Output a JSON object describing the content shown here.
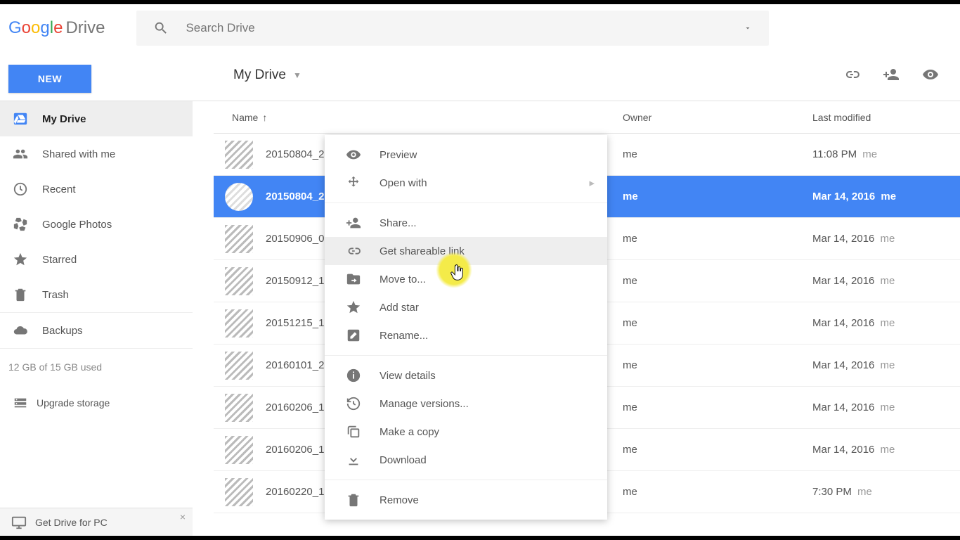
{
  "logo": {
    "g1": "G",
    "g2": "o",
    "g3": "o",
    "g4": "g",
    "g5": "l",
    "g6": "e",
    "drive": "Drive"
  },
  "search": {
    "placeholder": "Search Drive"
  },
  "new_button": "NEW",
  "breadcrumb": "My Drive",
  "sidebar": {
    "items": [
      {
        "label": "My Drive"
      },
      {
        "label": "Shared with me"
      },
      {
        "label": "Recent"
      },
      {
        "label": "Google Photos"
      },
      {
        "label": "Starred"
      },
      {
        "label": "Trash"
      }
    ],
    "backups": "Backups",
    "storage": "12 GB of 15 GB used",
    "upgrade": "Upgrade storage"
  },
  "columns": {
    "name": "Name",
    "owner": "Owner",
    "modified": "Last modified"
  },
  "files": [
    {
      "name": "20150804_2",
      "owner": "me",
      "modified": "11:08 PM",
      "by": "me"
    },
    {
      "name": "20150804_2",
      "owner": "me",
      "modified": "Mar 14, 2016",
      "by": "me"
    },
    {
      "name": "20150906_0",
      "owner": "me",
      "modified": "Mar 14, 2016",
      "by": "me"
    },
    {
      "name": "20150912_1",
      "owner": "me",
      "modified": "Mar 14, 2016",
      "by": "me"
    },
    {
      "name": "20151215_1",
      "owner": "me",
      "modified": "Mar 14, 2016",
      "by": "me"
    },
    {
      "name": "20160101_2",
      "owner": "me",
      "modified": "Mar 14, 2016",
      "by": "me"
    },
    {
      "name": "20160206_1",
      "owner": "me",
      "modified": "Mar 14, 2016",
      "by": "me"
    },
    {
      "name": "20160206_1",
      "owner": "me",
      "modified": "Mar 14, 2016",
      "by": "me"
    },
    {
      "name": "20160220_1",
      "owner": "me",
      "modified": "7:30 PM",
      "by": "me"
    }
  ],
  "contextmenu": {
    "preview": "Preview",
    "openwith": "Open with",
    "share": "Share...",
    "getlink": "Get shareable link",
    "moveto": "Move to...",
    "addstar": "Add star",
    "rename": "Rename...",
    "viewdetails": "View details",
    "versions": "Manage versions...",
    "copy": "Make a copy",
    "download": "Download",
    "remove": "Remove"
  },
  "bottombar": {
    "label": "Get Drive for PC",
    "close": "×"
  }
}
